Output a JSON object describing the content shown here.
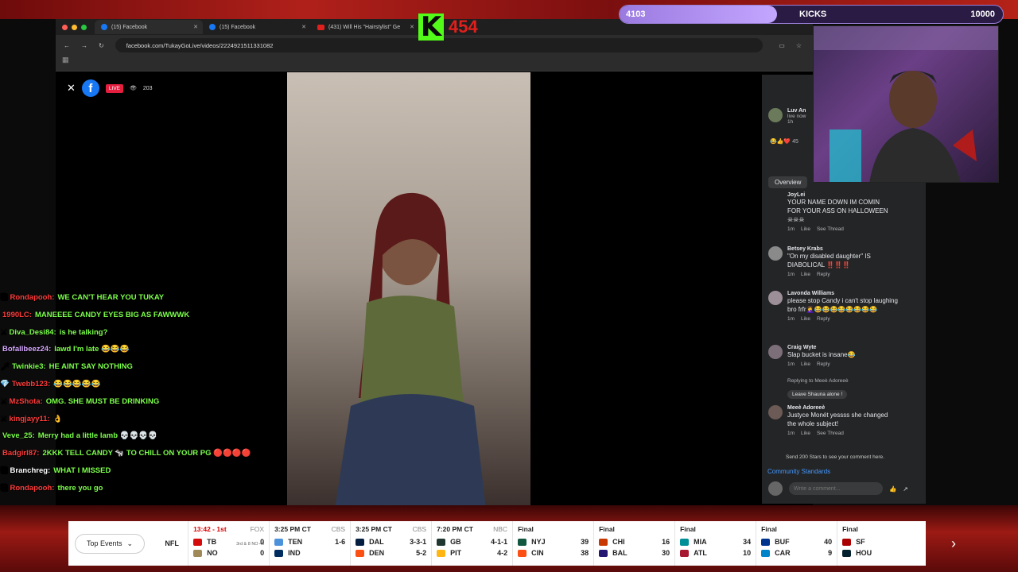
{
  "browser": {
    "tabs": [
      {
        "label": "(15) Facebook",
        "icon": "facebook-icon"
      },
      {
        "label": "(15) Facebook",
        "icon": "facebook-icon"
      },
      {
        "label": "(431) Will His \"Hairstylist\" Ge",
        "icon": "youtube-icon"
      }
    ],
    "new_tab": "+",
    "url": "facebook.com/TukayGoLive/videos/2224921511331082"
  },
  "live": {
    "close": "✕",
    "fb": "f",
    "badge": "LIVE",
    "viewers": "203"
  },
  "kick_overlay": {
    "number": "454",
    "logo": "K",
    "color": "#53fc18"
  },
  "goal_bar": {
    "current": "4103",
    "label": "KICKS",
    "goal": "10000",
    "fraction": 0.41
  },
  "chat": [
    {
      "user": "Rondapooh:",
      "msg": "WE CAN'T HEAR YOU TUKAY",
      "color": "#ff3b3b",
      "badge": "🅺"
    },
    {
      "user": "1990LC:",
      "msg": "MANEEEE CANDY EYES BIG AS FAWWWK",
      "color": "#ff3b3b",
      "badge": ""
    },
    {
      "user": "Diva_Desi84:",
      "msg": "is he talking?",
      "color": "#7cff4a",
      "badge": "⚔"
    },
    {
      "user": "Bofallbeez24:",
      "msg": "lawd I'm late 😂😂😂",
      "color": "#d6a8ff",
      "badge": ""
    },
    {
      "user": "Twinkie3:",
      "msg": "HE AINT SAY NOTHING",
      "color": "#7cff4a",
      "badge": "🗡"
    },
    {
      "user": "Twebb123:",
      "msg": "😂😂😂😂😂",
      "color": "#ff3b3b",
      "badge": "💎"
    },
    {
      "user": "MzShota:",
      "msg": "OMG. SHE MUST BE DRINKING",
      "color": "#ff3b3b",
      "badge": "⚔"
    },
    {
      "user": "kingjayy11:",
      "msg": "👌",
      "color": "#ff3b3b",
      "badge": "⚔"
    },
    {
      "user": "Veve_25:",
      "msg": "Merry had a little lamb 💀💀💀💀",
      "color": "#7cff4a",
      "badge": ""
    },
    {
      "user": "Badgirl87:",
      "msg": "2KKK TELL CANDY 🐄 TO CHILL ON YOUR PG 🔴🔴🔴🔴",
      "color": "#ff3b3b",
      "badge": ""
    },
    {
      "user": "Branchreg:",
      "msg": "WHAT I MISSED",
      "color": "#ffffff",
      "badge": "🅰"
    },
    {
      "user": "Rondapooh:",
      "msg": "there you go",
      "color": "#ff3b3b",
      "badge": "🅺"
    }
  ],
  "comments_panel": {
    "host": "Luv An",
    "host_status": "live now",
    "host_time": "1h",
    "reactions_count": "45",
    "overview": "Overview",
    "comments": [
      {
        "name": "JoyLei",
        "body": "YOUR NAME DOWN IM COMIN FOR YOUR ASS ON HALLOWEEN ☠☠☠",
        "time": "1m",
        "a1": "Like",
        "a2": "See Thread"
      },
      {
        "name": "Betsey Krabs",
        "body": "\"On my disabled daughter\" IS DIABOLICAL ‼️‼️‼️",
        "time": "1m",
        "a1": "Like",
        "a2": "Reply"
      },
      {
        "name": "Lavonda Williams",
        "body": "please stop Candy i can't stop laughing bro frfr🤦‍♀️😂😂😂😂😂😂😂😂",
        "time": "1m",
        "a1": "Like",
        "a2": "Reply"
      },
      {
        "name": "Craig Wyte",
        "body": "Slap bucket is insane😂",
        "time": "1m",
        "a1": "Like",
        "a2": "Reply"
      },
      {
        "name": "Meeè Adoreeè",
        "body": "Justyce Monét yessss she changed the whole subject!",
        "time": "1m",
        "a1": "Like",
        "a2": "See Thread"
      }
    ],
    "replying": "Replying to Meeè Adoreeè",
    "reply_text": "Leave Shauna alone !",
    "stars": "Send 200 Stars to see your comment here.",
    "community": "Community Standards",
    "placeholder": "Write a comment..."
  },
  "scores": {
    "top_events": "Top Events",
    "league": "NFL",
    "games": [
      {
        "status": "13:42 - 1st",
        "net": "FOX",
        "t1": "TB",
        "s1": "0",
        "t2": "NO",
        "s2": "0",
        "extra": "3rd & 8 NO 49",
        "c1": "#d50a0a",
        "c2": "#9f8958",
        "live": true
      },
      {
        "status": "3:25 PM CT",
        "net": "CBS",
        "t1": "TEN",
        "s1": "1-6",
        "t2": "IND",
        "s2": "",
        "c1": "#4b92db",
        "c2": "#002c5f"
      },
      {
        "status": "3:25 PM CT",
        "net": "CBS",
        "t1": "DAL",
        "s1": "3-3-1",
        "t2": "DEN",
        "s2": "5-2",
        "c1": "#041e42",
        "c2": "#fb4f14"
      },
      {
        "status": "7:20 PM CT",
        "net": "NBC",
        "t1": "GB",
        "s1": "4-1-1",
        "t2": "PIT",
        "s2": "4-2",
        "c1": "#203731",
        "c2": "#ffb612"
      },
      {
        "status": "Final",
        "net": "",
        "t1": "NYJ",
        "s1": "39",
        "t2": "CIN",
        "s2": "38",
        "c1": "#125740",
        "c2": "#fb4f14"
      },
      {
        "status": "Final",
        "net": "",
        "t1": "CHI",
        "s1": "16",
        "t2": "BAL",
        "s2": "30",
        "c1": "#c83803",
        "c2": "#241773"
      },
      {
        "status": "Final",
        "net": "",
        "t1": "MIA",
        "s1": "34",
        "t2": "ATL",
        "s2": "10",
        "c1": "#008e97",
        "c2": "#a71930"
      },
      {
        "status": "Final",
        "net": "",
        "t1": "BUF",
        "s1": "40",
        "t2": "CAR",
        "s2": "9",
        "c1": "#00338d",
        "c2": "#0085ca"
      },
      {
        "status": "Final",
        "net": "",
        "t1": "SF",
        "s1": "",
        "t2": "HOU",
        "s2": "",
        "c1": "#aa0000",
        "c2": "#03202f"
      }
    ],
    "next": "›"
  }
}
